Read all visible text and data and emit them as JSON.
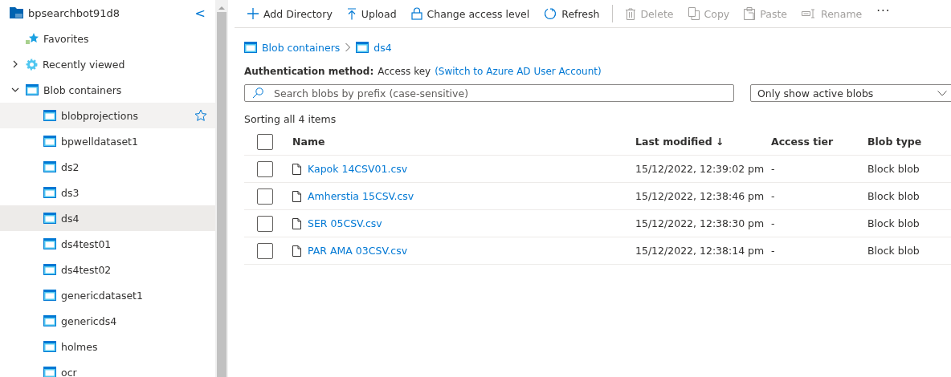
{
  "sidebar": {
    "root": {
      "label": "bpsearchbot91d8",
      "collapse": "<"
    },
    "items": [
      {
        "label": "Favorites",
        "kind": "favorites"
      },
      {
        "label": "Recently viewed",
        "kind": "recent",
        "expanded": false
      },
      {
        "label": "Blob containers",
        "kind": "containers",
        "expanded": true,
        "children": [
          {
            "label": "blobprojections",
            "selected": false,
            "hovered": true
          },
          {
            "label": "bpwelldataset1",
            "selected": false,
            "hovered": false
          },
          {
            "label": "ds2",
            "selected": false,
            "hovered": false
          },
          {
            "label": "ds3",
            "selected": false,
            "hovered": false
          },
          {
            "label": "ds4",
            "selected": true,
            "hovered": false
          },
          {
            "label": "ds4test01",
            "selected": false,
            "hovered": false
          },
          {
            "label": "ds4test02",
            "selected": false,
            "hovered": false
          },
          {
            "label": "genericdataset1",
            "selected": false,
            "hovered": false
          },
          {
            "label": "genericds4",
            "selected": false,
            "hovered": false
          },
          {
            "label": "holmes",
            "selected": false,
            "hovered": false
          },
          {
            "label": "ocr",
            "selected": false,
            "hovered": false
          }
        ]
      }
    ]
  },
  "toolbar": [
    {
      "label": "Add Directory",
      "kind": "add",
      "disabled": false
    },
    {
      "label": "Upload",
      "kind": "upload",
      "disabled": false
    },
    {
      "label": "Change access level",
      "kind": "lock",
      "disabled": false
    },
    {
      "label": "Refresh",
      "kind": "refresh",
      "disabled": false
    },
    {
      "kind": "separator"
    },
    {
      "label": "Delete",
      "kind": "delete",
      "disabled": true
    },
    {
      "label": "Copy",
      "kind": "copy",
      "disabled": true
    },
    {
      "label": "Paste",
      "kind": "paste",
      "disabled": true
    },
    {
      "label": "Rename",
      "kind": "rename",
      "disabled": true
    },
    {
      "label": "···",
      "kind": "more",
      "disabled": false
    }
  ],
  "breadcrumb": [
    "Blob containers",
    "ds4"
  ],
  "auth": {
    "label": "Authentication method:",
    "value": "Access key",
    "link": "(Switch to Azure AD User Account)"
  },
  "search": {
    "placeholder": "Search blobs by prefix (case-sensitive)"
  },
  "filter": {
    "value": "Only show active blobs"
  },
  "summary": "Sorting all 4 items",
  "table": {
    "select_all": {
      "checked": false
    },
    "columns": [
      "Name",
      "Last modified ↓",
      "Access tier",
      "Blob type"
    ],
    "rows": [
      {
        "name": "Kapok 14CSV01.csv",
        "modified": "15/12/2022, 12:39:02 pm",
        "tier": "-",
        "type": "Block blob",
        "checked": false
      },
      {
        "name": "Amherstia 15CSV.csv",
        "modified": "15/12/2022, 12:38:46 pm",
        "tier": "-",
        "type": "Block blob",
        "checked": false
      },
      {
        "name": "SER 05CSV.csv",
        "modified": "15/12/2022, 12:38:30 pm",
        "tier": "-",
        "type": "Block blob",
        "checked": false
      },
      {
        "name": "PAR AMA 03CSV.csv",
        "modified": "15/12/2022, 12:38:14 pm",
        "tier": "-",
        "type": "Block blob",
        "checked": false
      }
    ]
  }
}
